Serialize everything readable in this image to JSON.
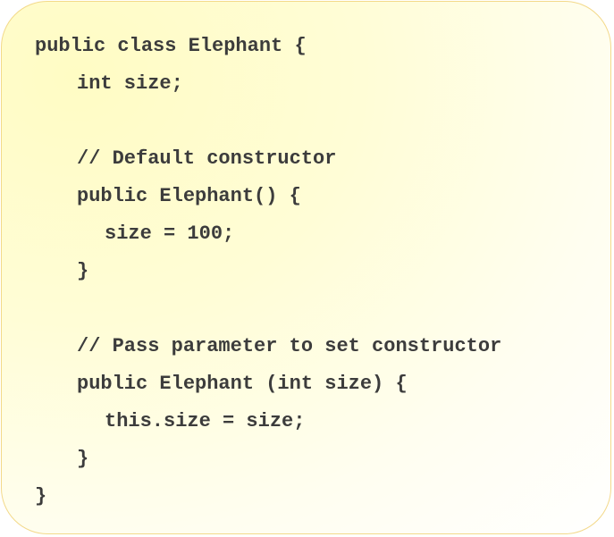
{
  "code": {
    "lines": [
      "public class Elephant {",
      "int size;",
      "",
      "// Default constructor",
      "public Elephant() {",
      "size = 100;",
      "}",
      "",
      "// Pass parameter to set constructor",
      "public Elephant (int size) {",
      "this.size = size;",
      "}",
      "}"
    ]
  }
}
